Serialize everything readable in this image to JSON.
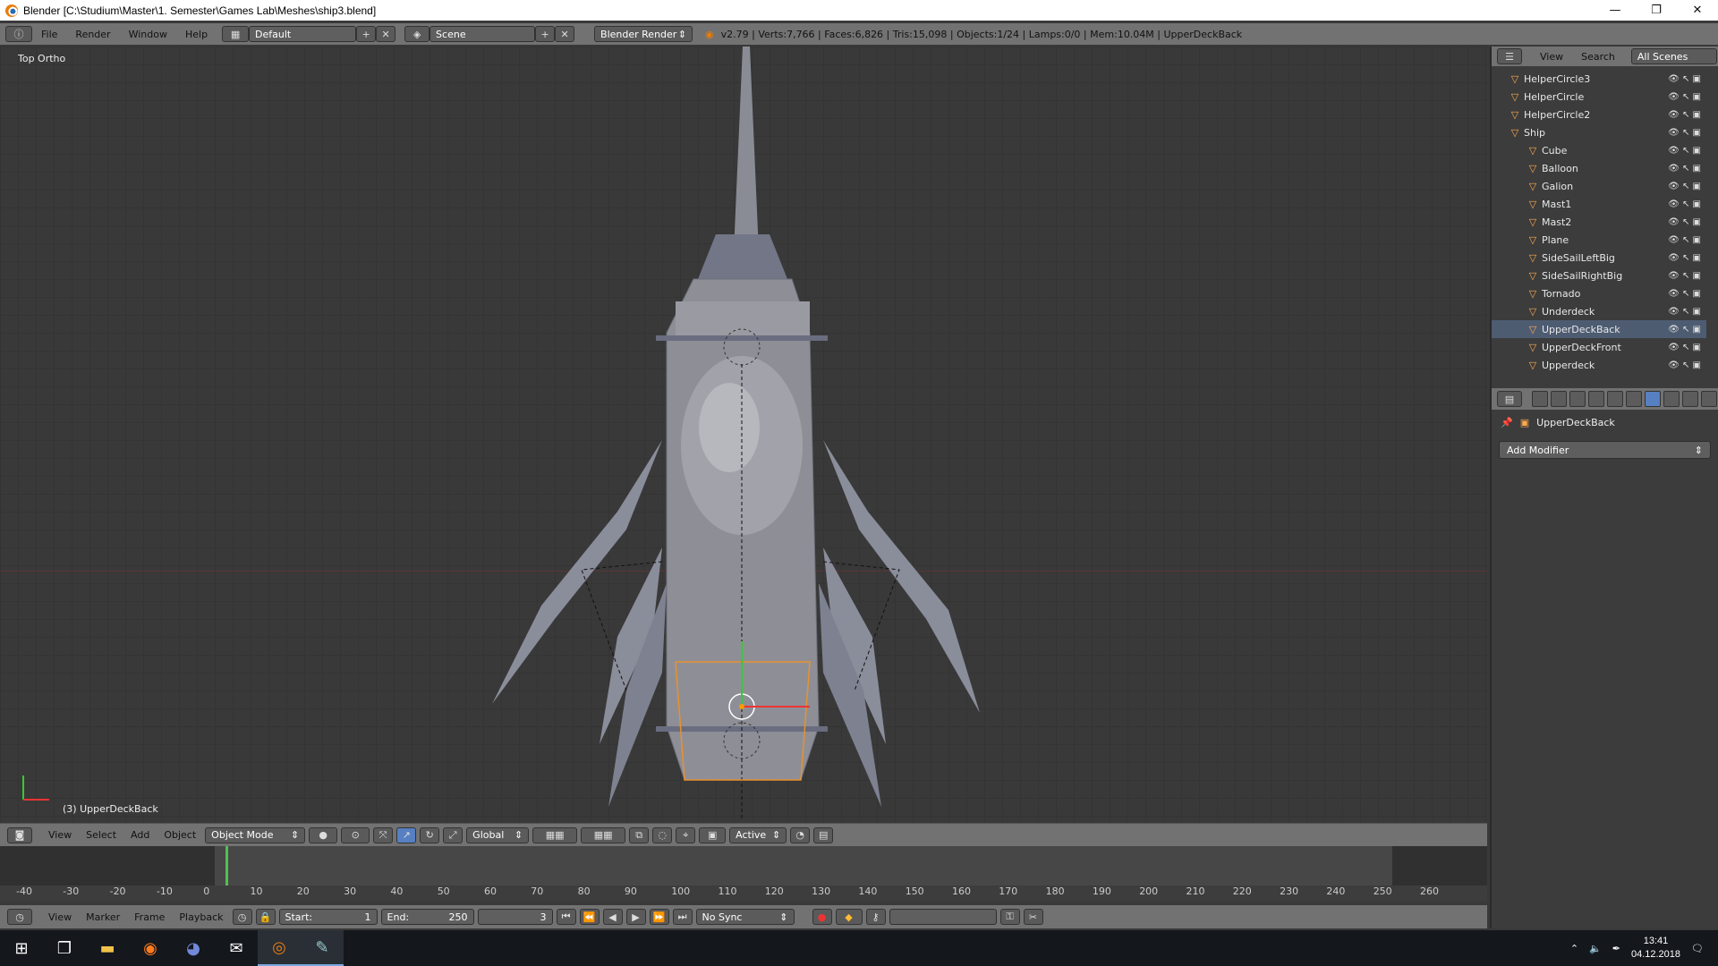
{
  "window": {
    "title": "Blender [C:\\Studium\\Master\\1. Semester\\Games Lab\\Meshes\\ship3.blend]",
    "min": "—",
    "max": "❐",
    "close": "✕"
  },
  "infobar": {
    "menus": [
      "File",
      "Render",
      "Window",
      "Help"
    ],
    "layout": "Default",
    "scene": "Scene",
    "engine": "Blender Render",
    "stats": "v2.79 | Verts:7,766 | Faces:6,826 | Tris:15,098 | Objects:1/24 | Lamps:0/0 | Mem:10.04M | UpperDeckBack"
  },
  "viewport": {
    "view_label": "Top Ortho",
    "object_label": "(3) UpperDeckBack"
  },
  "viewport_header": {
    "menus": [
      "View",
      "Select",
      "Add",
      "Object"
    ],
    "mode": "Object Mode",
    "orientation": "Global",
    "pivot": "Active"
  },
  "timeline": {
    "ticks": [
      "-40",
      "-30",
      "-20",
      "-10",
      "0",
      "10",
      "20",
      "30",
      "40",
      "50",
      "60",
      "70",
      "80",
      "90",
      "100",
      "110",
      "120",
      "130",
      "140",
      "150",
      "160",
      "170",
      "180",
      "190",
      "200",
      "210",
      "220",
      "230",
      "240",
      "250",
      "260"
    ],
    "menus": [
      "View",
      "Marker",
      "Frame",
      "Playback"
    ],
    "start_label": "Start:",
    "start": "1",
    "end_label": "End:",
    "end": "250",
    "current": "3",
    "sync": "No Sync"
  },
  "outliner": {
    "menus": [
      "View",
      "Search"
    ],
    "filter": "All Scenes",
    "items": [
      {
        "name": "HelperCircle3",
        "depth": 0
      },
      {
        "name": "HelperCircle",
        "depth": 0
      },
      {
        "name": "HelperCircle2",
        "depth": 0
      },
      {
        "name": "Ship",
        "depth": 0
      },
      {
        "name": "Cube",
        "depth": 1
      },
      {
        "name": "Balloon",
        "depth": 1
      },
      {
        "name": "Galion",
        "depth": 1
      },
      {
        "name": "Mast1",
        "depth": 1
      },
      {
        "name": "Mast2",
        "depth": 1
      },
      {
        "name": "Plane",
        "depth": 1
      },
      {
        "name": "SideSailLeftBig",
        "depth": 1
      },
      {
        "name": "SideSailRightBig",
        "depth": 1
      },
      {
        "name": "Tornado",
        "depth": 1
      },
      {
        "name": "Underdeck",
        "depth": 1
      },
      {
        "name": "UpperDeckBack",
        "depth": 1
      },
      {
        "name": "UpperDeckFront",
        "depth": 1
      },
      {
        "name": "Upperdeck",
        "depth": 1
      }
    ]
  },
  "properties": {
    "object_name": "UpperDeckBack",
    "add_modifier": "Add Modifier"
  },
  "taskbar": {
    "time": "13:41",
    "date": "04.12.2018"
  },
  "colors": {
    "accent_blue": "#5680c2",
    "timeline_cursor": "#4ec34e",
    "selection_orange": "#ffa94d"
  }
}
